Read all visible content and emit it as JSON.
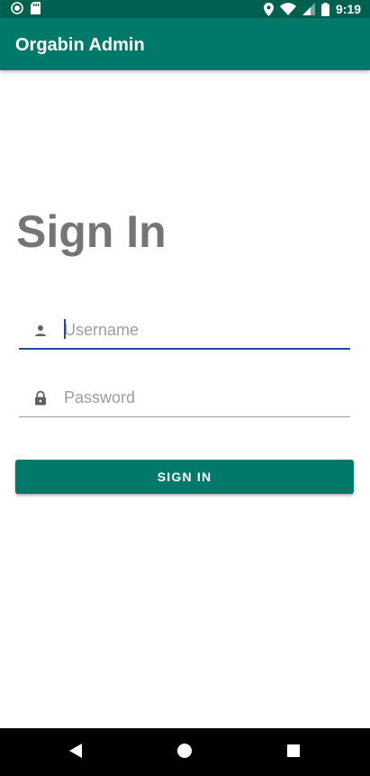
{
  "status_bar": {
    "time": "9:19",
    "left_icons": [
      "record-icon",
      "sd-card-icon"
    ],
    "right_icons": [
      "location-icon",
      "wifi-icon",
      "signal-icon",
      "battery-icon"
    ]
  },
  "app_bar": {
    "title": "Orgabin Admin"
  },
  "main": {
    "heading": "Sign In",
    "username": {
      "placeholder": "Username",
      "value": "",
      "icon": "person-icon",
      "focused": true
    },
    "password": {
      "placeholder": "Password",
      "value": "",
      "icon": "lock-icon"
    },
    "signin_label": "SIGN IN"
  },
  "nav_bar": {
    "buttons": [
      "back-icon",
      "home-icon",
      "recents-icon"
    ]
  },
  "colors": {
    "primary": "#00796b",
    "primary_dark": "#00604f",
    "focus": "#1a4fa0",
    "heading": "#757575"
  }
}
